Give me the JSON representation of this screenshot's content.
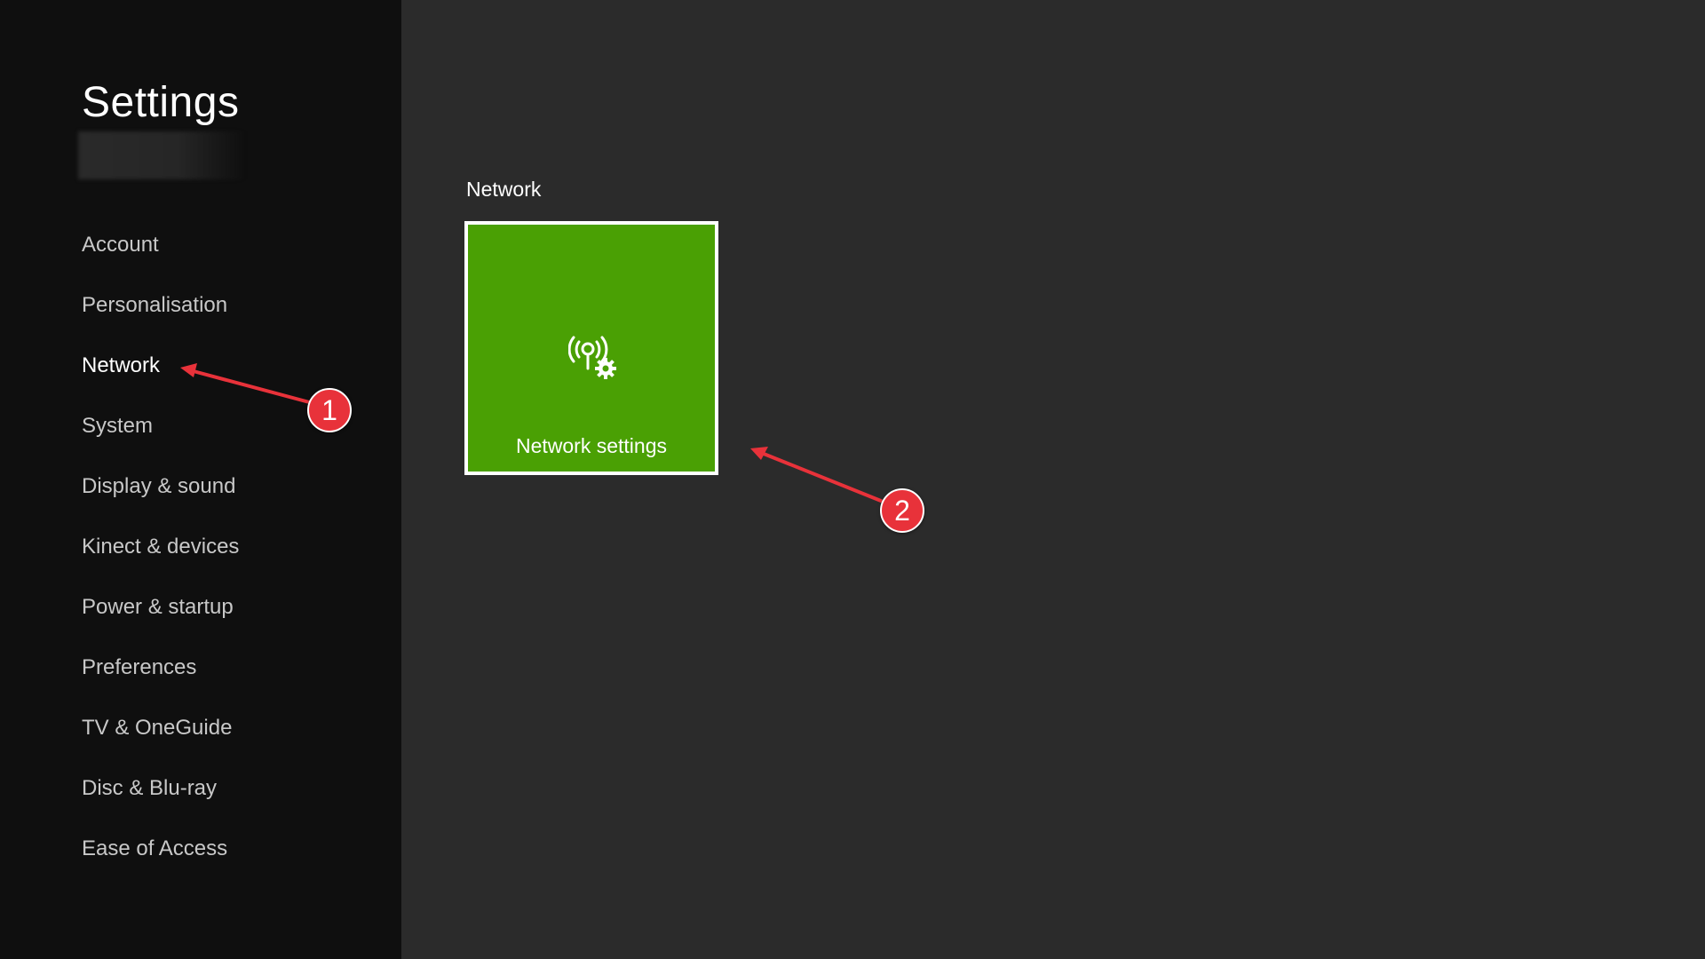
{
  "sidebar": {
    "title": "Settings",
    "items": [
      {
        "label": "Account",
        "selected": false
      },
      {
        "label": "Personalisation",
        "selected": false
      },
      {
        "label": "Network",
        "selected": true
      },
      {
        "label": "System",
        "selected": false
      },
      {
        "label": "Display & sound",
        "selected": false
      },
      {
        "label": "Kinect & devices",
        "selected": false
      },
      {
        "label": "Power & startup",
        "selected": false
      },
      {
        "label": "Preferences",
        "selected": false
      },
      {
        "label": "TV & OneGuide",
        "selected": false
      },
      {
        "label": "Disc & Blu-ray",
        "selected": false
      },
      {
        "label": "Ease of Access",
        "selected": false
      }
    ]
  },
  "main": {
    "section_label": "Network",
    "tile": {
      "label": "Network settings",
      "icon": "network-settings-icon"
    }
  },
  "annotations": {
    "callout_1": "1",
    "callout_2": "2"
  },
  "colors": {
    "background": "#2b2b2b",
    "sidebar": "#0f0f0f",
    "tile": "#4aa004",
    "annotation": "#e8323a"
  }
}
